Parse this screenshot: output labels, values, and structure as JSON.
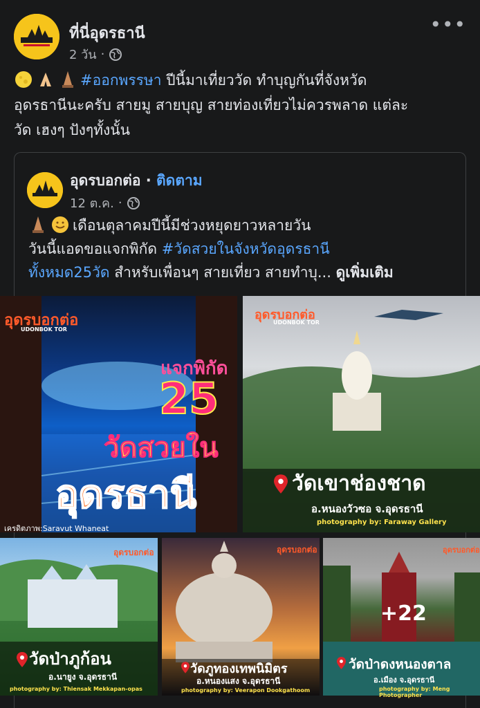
{
  "post": {
    "author": "ที่นี่อุดรธานี",
    "time": "2 วัน",
    "hashtag": "#ออกพรรษา",
    "text_line1_rest": " ปีนี้มาเที่ยววัด ทำบุญกันที่จังหวัด",
    "text_line2": "อุดรธานีนะครับ สายมู สายบุญ สายท่องเที่ยวไม่ควรพลาด แต่ละ",
    "text_line3": "วัด เฮงๆ ปังๆทั้งนั้น",
    "emojis": [
      "moon-icon",
      "praying-hands-icon",
      "temple-icon"
    ]
  },
  "shared": {
    "author": "อุดรบอกต่อ",
    "separator": " · ",
    "follow": "ติดตาม",
    "time": "12 ต.ค.",
    "line1": "เดือนตุลาคมปีนี้มีช่วงหยุดยาวหลายวัน",
    "line2_pre": "วันนี้แอดขอแจกพิกัด ",
    "hashtag": "#วัดสวยในจังหวัดอุดรธานี",
    "hashtag2": "ทั้งหมด25วัด",
    "line3_rest": " สำหรับเพื่อนๆ สายเที่ยว สายทำบุ...",
    "see_more": "ดูเพิ่มเติม",
    "emojis": [
      "temple-icon",
      "smiling-face-icon"
    ]
  },
  "photos": {
    "brand": "อุดรบอกต่อ",
    "brand_sub": "UDONBOK TOR",
    "p1": {
      "jaek": "แจกพิกัด",
      "num": "25",
      "watsuay": "วัดสวยใน",
      "udon": "อุดรธานี",
      "credit": "เครดิตภาพ:Saravut Whaneat"
    },
    "p2": {
      "title": "วัดเขาช่องชาด",
      "sub": "อ.หนองวัวซอ จ.อุดรธานี",
      "photo": "photography by: Faraway Gallery"
    },
    "p3": {
      "title": "วัดป่าภูก้อน",
      "sub": "อ.นายูง จ.อุดรธานี",
      "photo": "photography by: Thiensak Mekkapan-opas"
    },
    "p4": {
      "title": "วัดภูทองเทพนิมิตร",
      "sub": "อ.หนองแสง จ.อุดรธานี",
      "photo": "photography by: Veerapon Dookgathoom"
    },
    "p5": {
      "title": "วัดป่าดงหนองตาล",
      "sub": "อ.เมือง จ.อุดรธานี",
      "photo": "photography by: Meng Photographer",
      "more": "+22"
    }
  }
}
